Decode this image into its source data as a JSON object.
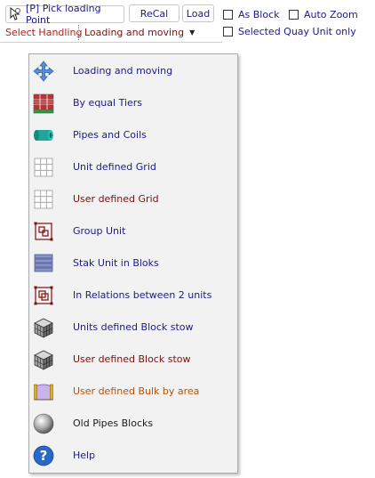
{
  "toolbar": {
    "pick_label": "[P] Pick loading Point",
    "recal_label": "ReCal",
    "load_label": "Load",
    "as_block_label": "As Block",
    "auto_zoom_label": "Auto Zoom",
    "selected_quay_label": "Selected Quay Unit only",
    "select_handling_label": "Select Handling",
    "handling_value": "Loading and moving"
  },
  "menu": {
    "items": [
      {
        "label": "Loading and moving",
        "icon": "move-arrows-icon",
        "color": "#1a1a8c"
      },
      {
        "label": "By equal Tiers",
        "icon": "tiers-icon",
        "color": "#1a1a8c"
      },
      {
        "label": "Pipes and Coils",
        "icon": "pipe-icon",
        "color": "#1a1a8c"
      },
      {
        "label": "Unit defined Grid",
        "icon": "grid-icon",
        "color": "#1a1a8c"
      },
      {
        "label": "User defined Grid",
        "icon": "user-grid-icon",
        "color": "#7a1010"
      },
      {
        "label": "Group Unit",
        "icon": "group-unit-icon",
        "color": "#1a1a8c"
      },
      {
        "label": "Stak Unit in Bloks",
        "icon": "stack-icon",
        "color": "#1a1a8c"
      },
      {
        "label": "In Relations between 2 units",
        "icon": "relation-icon",
        "color": "#1a1a8c"
      },
      {
        "label": "Units defined Block stow",
        "icon": "cube-icon",
        "color": "#1a1a8c"
      },
      {
        "label": "User defined Block stow",
        "icon": "user-cube-icon",
        "color": "#7a1010"
      },
      {
        "label": "User defined Bulk by area",
        "icon": "bulk-area-icon",
        "color": "#b8520a"
      },
      {
        "label": "Old Pipes Blocks",
        "icon": "sphere-icon",
        "color": "#1a1a1a"
      },
      {
        "label": "Help",
        "icon": "help-icon",
        "color": "#1a1a8c"
      }
    ]
  }
}
